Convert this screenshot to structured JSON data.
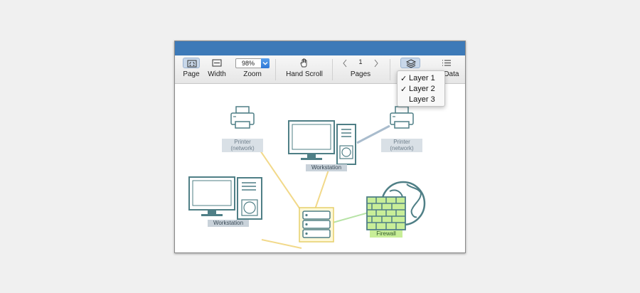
{
  "toolbar": {
    "page_label": "Page",
    "width_label": "Width",
    "zoom_label": "Zoom",
    "zoom_value": "98%",
    "hand_scroll_label": "Hand Scroll",
    "pages_label": "Pages",
    "page_number": "1",
    "data_label": "e Data"
  },
  "layers_menu": {
    "items": [
      {
        "label": "Layer 1",
        "checked": "✓"
      },
      {
        "label": "Layer 2",
        "checked": "✓"
      },
      {
        "label": "Layer 3",
        "checked": ""
      }
    ]
  },
  "diagram": {
    "printer_left": {
      "line1": "Printer",
      "line2": "(network)"
    },
    "printer_right": {
      "line1": "Printer",
      "line2": "(network)"
    },
    "workstation_top": "Workstation",
    "workstation_left": "Workstation",
    "firewall": "Firewall"
  },
  "colors": {
    "titlebar": "#3d7ab8",
    "device_stroke": "#4f7f86",
    "link_yellow": "#f2d98a",
    "link_blue": "#a9bccd",
    "link_green": "#b7e3a6",
    "firewall_fill": "#c8ee98"
  }
}
